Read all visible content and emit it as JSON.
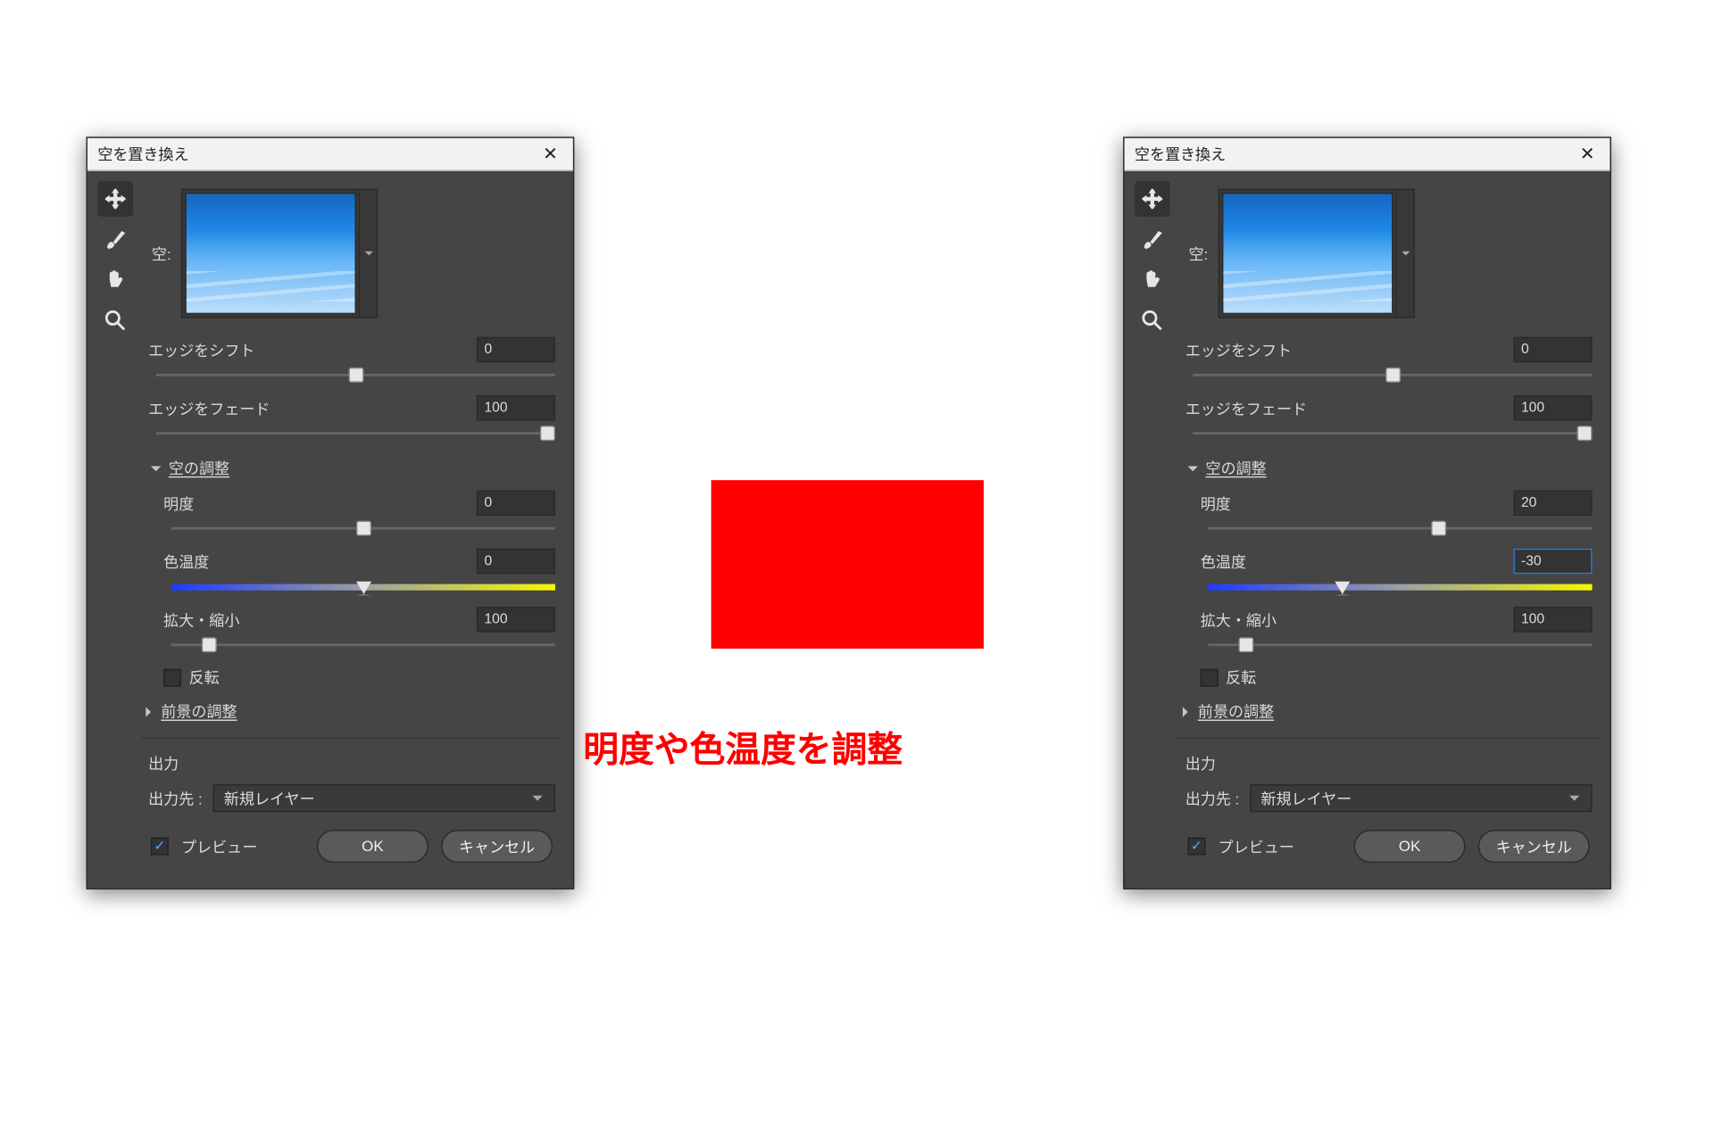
{
  "left_dialog": {
    "title": "空を置き換え",
    "sky_label": "空:",
    "edge_shift": {
      "label": "エッジをシフト",
      "value": "0",
      "pos": 50
    },
    "edge_fade": {
      "label": "エッジをフェード",
      "value": "100",
      "pos": 100
    },
    "section_sky_adjust": "空の調整",
    "brightness": {
      "label": "明度",
      "value": "0",
      "pos": 50
    },
    "color_temp": {
      "label": "色温度",
      "value": "0",
      "pos": 50
    },
    "scale": {
      "label": "拡大・縮小",
      "value": "100",
      "pos": 10
    },
    "flip_label": "反転",
    "fg_adjust_label": "前景の調整",
    "output_header": "出力",
    "output_to_label": "出力先 :",
    "output_to_value": "新規レイヤー",
    "preview_label": "プレビュー",
    "ok": "OK",
    "cancel": "キャンセル"
  },
  "right_dialog": {
    "title": "空を置き換え",
    "sky_label": "空:",
    "edge_shift": {
      "label": "エッジをシフト",
      "value": "0",
      "pos": 50
    },
    "edge_fade": {
      "label": "エッジをフェード",
      "value": "100",
      "pos": 100
    },
    "section_sky_adjust": "空の調整",
    "brightness": {
      "label": "明度",
      "value": "20",
      "pos": 60
    },
    "color_temp": {
      "label": "色温度",
      "value": "-30",
      "pos": 35,
      "hl": true
    },
    "scale": {
      "label": "拡大・縮小",
      "value": "100",
      "pos": 10
    },
    "flip_label": "反転",
    "fg_adjust_label": "前景の調整",
    "output_header": "出力",
    "output_to_label": "出力先 :",
    "output_to_value": "新規レイヤー",
    "preview_label": "プレビュー",
    "ok": "OK",
    "cancel": "キャンセル"
  },
  "annotation": "明度や色温度を調整"
}
